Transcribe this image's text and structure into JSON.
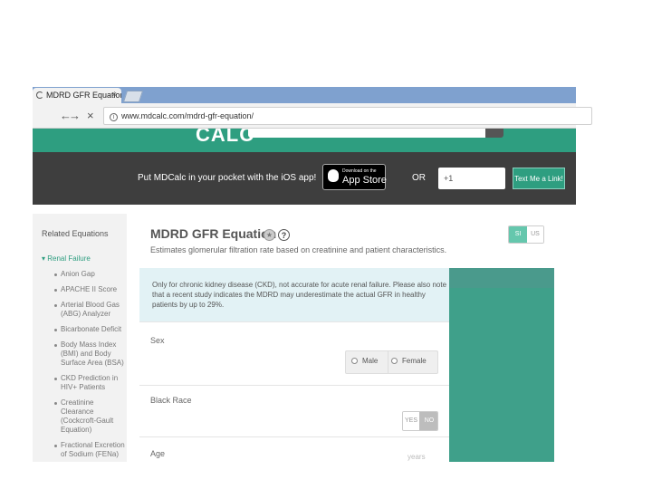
{
  "browser": {
    "tab_title": "MDRD GFR Equation - M",
    "tab_close": "×",
    "nav_back": "←",
    "nav_forward": "→",
    "nav_stop": "×",
    "info_symbol": "i",
    "url": "www.mdcalc.com/mdrd-gfr-equation/"
  },
  "site": {
    "logo": "CALC",
    "promo_text": "Put MDCalc in your pocket with the iOS app!",
    "appstore_small": "Download on the",
    "appstore_big": "App Store",
    "or_label": "OR",
    "phone_value": "+1",
    "text_link_button": "Text Me a Link!"
  },
  "sidebar": {
    "heading": "Related Equations",
    "category": "▾ Renal Failure",
    "items": [
      "Anion Gap",
      "APACHE II Score",
      "Arterial Blood Gas (ABG) Analyzer",
      "Bicarbonate Deficit",
      "Body Mass Index (BMI) and Body Surface Area (BSA)",
      "CKD Prediction in HIV+ Patients",
      "Creatinine Clearance (Cockcroft-Gault Equation)",
      "Fractional Excretion of Sodium (FENa)"
    ]
  },
  "calc": {
    "title": "MDRD GFR Equation",
    "star_symbol": "★",
    "help_symbol": "?",
    "subtitle": "Estimates glomerular filtration rate based on creatinine and patient characteristics.",
    "unit_si": "SI",
    "unit_us": "US",
    "info_text": "Only for chronic kidney disease (CKD), not accurate for acute renal failure. Please also note that a recent study indicates the MDRD may underestimate the actual GFR in healthy patients by up to 29%.",
    "sex_label": "Sex",
    "sex_male": "Male",
    "sex_female": "Female",
    "race_label": "Black Race",
    "race_yes": "YES",
    "race_no": "NO",
    "age_label": "Age",
    "age_unit": "years"
  },
  "colors": {
    "brand_green": "#2e9e80",
    "promo_dark": "#3e3e3e",
    "info_bg": "#e2f2f5"
  }
}
